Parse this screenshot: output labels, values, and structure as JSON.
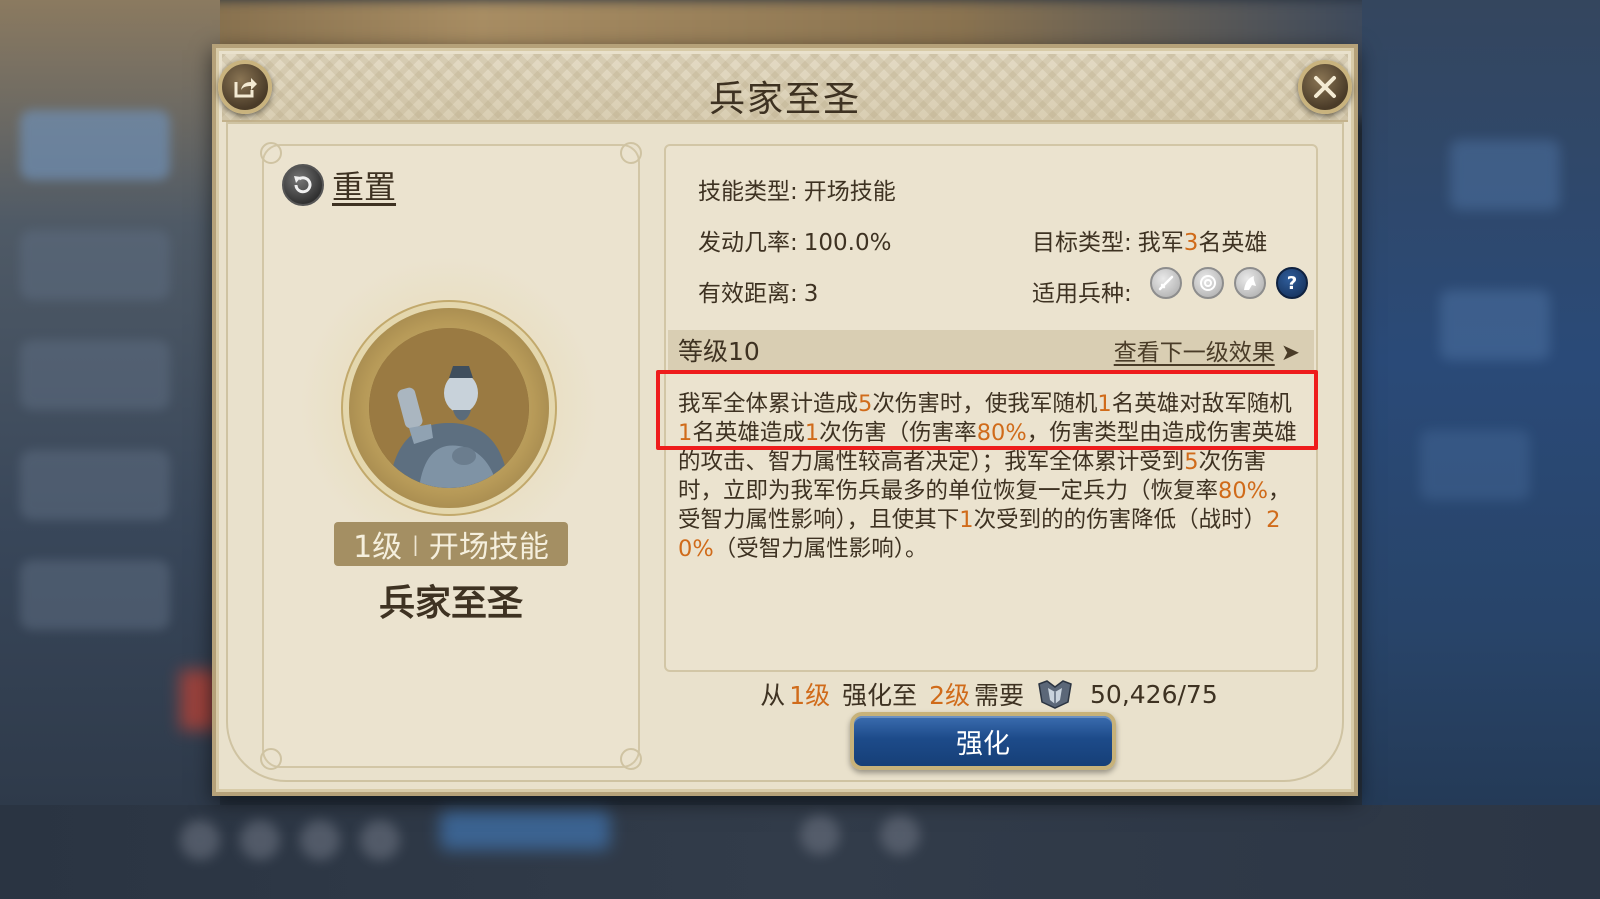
{
  "dialog": {
    "title": "兵家至圣",
    "share_icon": "share-icon",
    "close_icon": "close-icon"
  },
  "left_card": {
    "reset_label": "重置",
    "reset_icon": "reset-icon",
    "level_label": "1级",
    "type_label": "开场技能",
    "skill_name": "兵家至圣"
  },
  "info": {
    "skill_type_label": "技能类型:",
    "skill_type_value": "开场技能",
    "trigger_rate_label": "发动几率:",
    "trigger_rate_value": "100.0%",
    "range_label": "有效距离:",
    "range_value": "3",
    "target_label": "目标类型:",
    "target_prefix": "我军",
    "target_count": "3",
    "target_suffix": "名英雄",
    "troop_label": "适用兵种:",
    "troop_icons": [
      "sword-icon",
      "bow-target-icon",
      "cavalry-icon",
      "question-icon"
    ],
    "question_glyph": "?",
    "level_title": "等级10",
    "next_level_link": "查看下一级效果",
    "next_arrow": "➤"
  },
  "description": [
    {
      "t": "我军全体累计造成"
    },
    {
      "t": "5",
      "hl": true
    },
    {
      "t": "次伤害时，使我军随机"
    },
    {
      "t": "1",
      "hl": true
    },
    {
      "t": "名英雄对敌军随机"
    },
    {
      "t": "1",
      "hl": true
    },
    {
      "t": "名英雄造成"
    },
    {
      "t": "1",
      "hl": true
    },
    {
      "t": "次伤害（伤害率"
    },
    {
      "t": "80%",
      "hl": true
    },
    {
      "t": "，伤害类型由造成伤害英雄的攻击、智力属性较高者决定）；我军全体累计受到"
    },
    {
      "t": "5",
      "hl": true
    },
    {
      "t": "次伤害时，立即为我军伤兵最多的单位恢复一定兵力（恢复率"
    },
    {
      "t": "80%",
      "hl": true
    },
    {
      "t": "，受智力属性影响），且使其下"
    },
    {
      "t": "1",
      "hl": true
    },
    {
      "t": "次受到的的伤害降低（战时）"
    },
    {
      "t": "20%",
      "hl": true
    },
    {
      "t": "（受智力属性影响）。"
    }
  ],
  "upgrade": {
    "from_prefix": "从",
    "from_level": "1级",
    "middle": " 强化至 ",
    "to_level": "2级",
    "suffix": "需要",
    "resource_icon": "skill-token-icon",
    "cost": "50,426/75",
    "button_label": "强化"
  },
  "colors": {
    "highlight": "#d06b1a",
    "annotation_box": "#ee1c1c",
    "button_blue": "#1d4b8a",
    "panel_bg": "#e9e1cc"
  }
}
